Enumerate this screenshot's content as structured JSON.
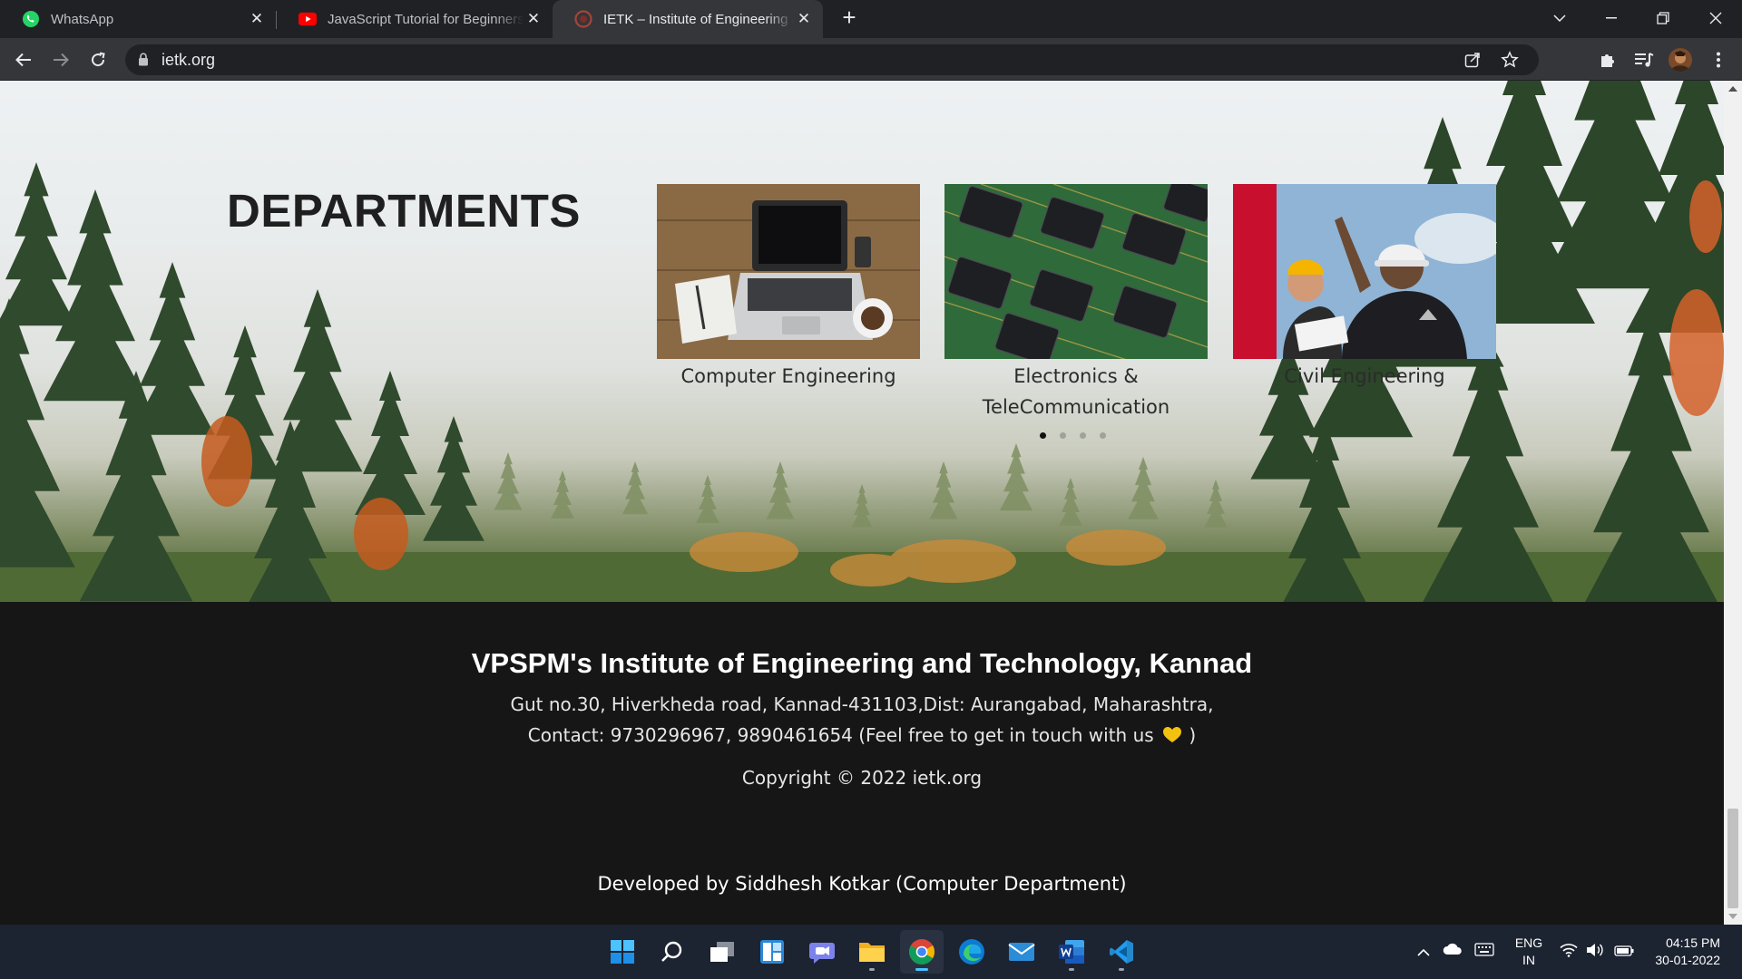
{
  "browser": {
    "tabs": [
      {
        "title": "WhatsApp",
        "icon": "whatsapp-icon",
        "active": false
      },
      {
        "title": "JavaScript Tutorial for Beginners: Learn",
        "icon": "youtube-icon",
        "active": false
      },
      {
        "title": "IETK – Institute of Engineering and Tech",
        "icon": "ietk-favicon-icon",
        "active": true
      }
    ],
    "url": "ietk.org"
  },
  "page": {
    "departments_title": "DEPARTMENTS",
    "departments": [
      {
        "name": "Computer Engineering",
        "image": "laptop-on-desk"
      },
      {
        "name": "Electronics & TeleCommunication",
        "image": "circuit-board-chips"
      },
      {
        "name": "Civil Engineering",
        "image": "engineer-in-hardhat"
      }
    ],
    "carousel": {
      "total_dots": 4,
      "active_index": 0
    }
  },
  "footer": {
    "institute_name": "VPSPM's Institute of Engineering and Technology, Kannad",
    "address": "Gut no.30, Hiverkheda road, Kannad-431103,Dist: Aurangabad, Maharashtra,",
    "contact": "Contact: 9730296967, 9890461654 (Feel free to get in touch with us",
    "contact_end": ")",
    "copyright": "Copyright © 2022 ietk.org",
    "developer": "Developed by Siddhesh Kotkar (Computer Department)"
  },
  "taskbar": {
    "apps": [
      "start-icon",
      "search-icon",
      "task-view-icon",
      "widgets-icon",
      "teams-chat-icon",
      "file-explorer-icon",
      "chrome-icon",
      "edge-icon",
      "mail-icon",
      "word-icon",
      "vscode-icon"
    ],
    "language": "ENG",
    "region": "IN",
    "time": "04:15 PM",
    "date": "30-01-2022"
  },
  "colors": {
    "footer_bg": "#161616",
    "accent": "#4cc2ff",
    "chrome_dark": "#202124"
  }
}
